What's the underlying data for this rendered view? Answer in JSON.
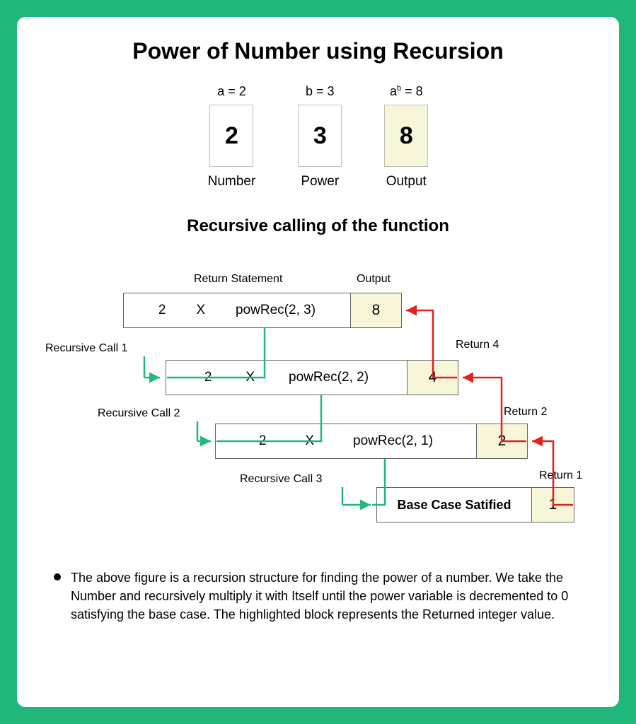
{
  "title": "Power of Number using Recursion",
  "top": {
    "a_label": "a = 2",
    "a_value": "2",
    "a_caption": "Number",
    "b_label": "b = 3",
    "b_value": "3",
    "b_caption": "Power",
    "out_label_pre": "a",
    "out_label_sup": "b",
    "out_label_post": " = 8",
    "out_value": "8",
    "out_caption": "Output"
  },
  "subtitle": "Recursive calling of the function",
  "headers": {
    "return_stmt": "Return Statement",
    "output": "Output"
  },
  "rows": [
    {
      "n": "2",
      "op": "X",
      "call": "powRec(2, 3)",
      "out": "8"
    },
    {
      "n": "2",
      "op": "X",
      "call": "powRec(2, 2)",
      "out": "4"
    },
    {
      "n": "2",
      "op": "X",
      "call": "powRec(2, 1)",
      "out": "2"
    },
    {
      "text": "Base Case Satified",
      "out": "1"
    }
  ],
  "call_labels": {
    "c1": "Recursive Call 1",
    "c2": "Recursive Call 2",
    "c3": "Recursive Call 3"
  },
  "return_labels": {
    "r4": "Return 4",
    "r2": "Return 2",
    "r1": "Return 1"
  },
  "description": "The above figure is a recursion structure for finding the power of a number. We take the Number and recursively multiply it with Itself until the power variable is decremented to 0 satisfying the base case. The highlighted block represents the Returned integer value."
}
